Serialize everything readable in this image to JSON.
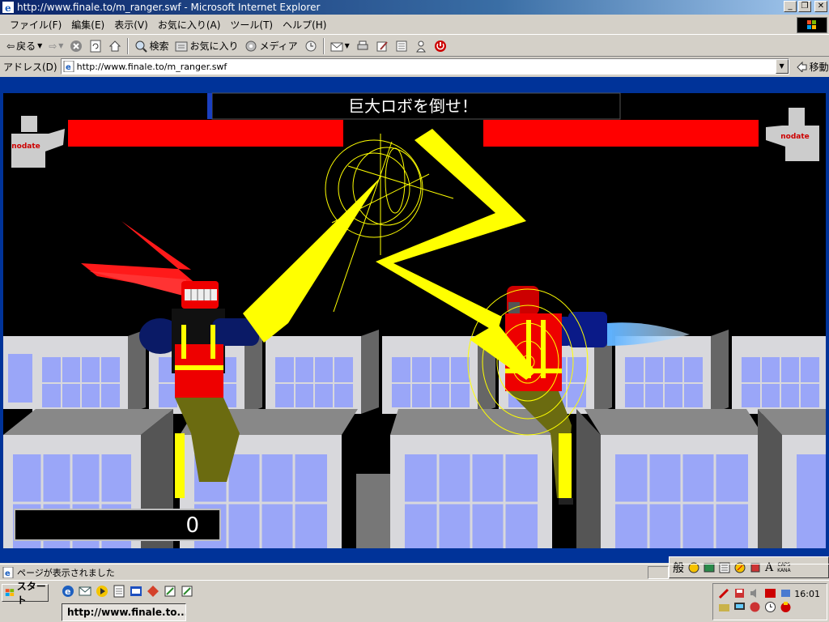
{
  "window": {
    "title": "http://www.finale.to/m_ranger.swf - Microsoft Internet Explorer",
    "buttons": [
      "0",
      "1",
      "r"
    ]
  },
  "menu": {
    "items": [
      "ファイル(F)",
      "編集(E)",
      "表示(V)",
      "お気に入り(A)",
      "ツール(T)",
      "ヘルプ(H)"
    ]
  },
  "toolbar": {
    "back": "戻る",
    "search": "検索",
    "favorites": "お気に入り",
    "media": "メディア"
  },
  "address": {
    "label": "アドレス(D)",
    "url": "http://www.finale.to/m_ranger.swf",
    "go": "移動"
  },
  "game": {
    "message": "巨大ロボを倒せ！",
    "player_label": "nodate",
    "enemy_label": "nodate",
    "score": "0",
    "player_health": 1.0,
    "enemy_health": 1.0,
    "colors": {
      "sky": "#000000",
      "frame": "#003399",
      "health": "#ff0000",
      "lightning": "#ffff00",
      "building": "#d8d8dc",
      "window": "#9aa6f8"
    }
  },
  "status": {
    "text": "ページが表示されました"
  },
  "ime": {
    "mode": "般",
    "caps": "CAPS",
    "kana": "KANA"
  },
  "taskbar": {
    "start": "スタート",
    "task": "http://www.finale.to...",
    "clock": "16:01"
  }
}
